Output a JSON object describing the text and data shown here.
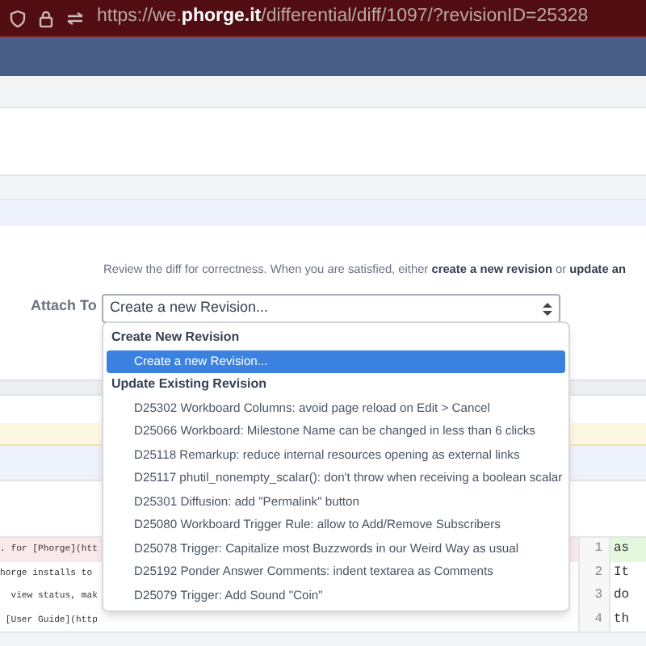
{
  "address_bar": {
    "url": "https://we.**phorge.it**/differential/diff/1097/?revisionID=25328"
  },
  "form": {
    "instructions": "Review the diff for correctness. When you are satisfied, either **create a new revision** or **update an**",
    "attach_label": "Attach To",
    "select_value": "Create a new Revision..."
  },
  "dropdown": {
    "groups": [
      {
        "label": "Create New Revision",
        "options": [
          {
            "label": "Create a new Revision...",
            "selected": true
          }
        ]
      },
      {
        "label": "Update Existing Revision",
        "options": [
          {
            "label": "D25302 Workboard Columns: avoid page reload on Edit > Cancel",
            "selected": false
          },
          {
            "label": "D25066 Workboard: Milestone Name can be changed in less than 6 clicks",
            "selected": false
          },
          {
            "label": "D25118 Remarkup: reduce internal resources opening as external links",
            "selected": false
          },
          {
            "label": "D25117 phutil_nonempty_scalar(): don't throw when receiving a boolean scalar",
            "selected": false
          },
          {
            "label": "D25301 Diffusion: add \"Permalink\" button",
            "selected": false
          },
          {
            "label": "D25080 Workboard Trigger Rule: allow to Add/Remove Subscribers",
            "selected": false
          },
          {
            "label": "D25078 Trigger: Capitalize most Buzzwords in our Weird Way as usual",
            "selected": false
          },
          {
            "label": "D25192 Ponder Answer Comments: indent textarea as Comments",
            "selected": false
          },
          {
            "label": "D25079 Trigger: Add Sound \"Coin\"",
            "selected": false
          }
        ]
      }
    ]
  },
  "diff": {
    "rows": [
      {
        "left": ". for [Phorge](htt",
        "number": "1",
        "right": "as",
        "kind": "changed"
      },
      {
        "left": "horge installs to",
        "number": "2",
        "right": "It",
        "kind": "plain"
      },
      {
        "left": "  view status, mak",
        "number": "3",
        "right": "do",
        "kind": "plain"
      },
      {
        "left": " [User Guide](http",
        "number": "4",
        "right": "th",
        "kind": "plain"
      }
    ]
  }
}
